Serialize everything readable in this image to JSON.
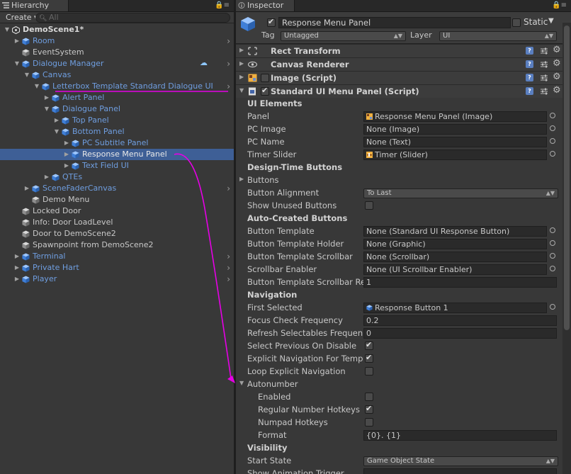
{
  "hierarchy": {
    "tab_label": "Hierarchy",
    "create_label": "Create ▾",
    "search_placeholder": "All",
    "items": [
      {
        "label": "DemoScene1*",
        "depth": 0,
        "expanded": true,
        "icon": "unity-scene-icon",
        "bold": true,
        "chevron": false
      },
      {
        "label": "Room",
        "depth": 1,
        "expanded": false,
        "icon": "prefab-cube-icon",
        "prefab": true,
        "chevron": true
      },
      {
        "label": "EventSystem",
        "depth": 1,
        "icon": "gameobject-cube-icon"
      },
      {
        "label": "Dialogue Manager",
        "depth": 1,
        "expanded": true,
        "icon": "prefab-cube-icon",
        "prefab": true,
        "chevron": true,
        "badge": true
      },
      {
        "label": "Canvas",
        "depth": 2,
        "expanded": true,
        "icon": "prefab-cube-icon",
        "prefab": true
      },
      {
        "label": "Letterbox Template Standard Dialogue UI",
        "depth": 3,
        "expanded": true,
        "icon": "prefab-cube-icon",
        "prefab": true,
        "chevron": true,
        "underline": true
      },
      {
        "label": "Alert Panel",
        "depth": 4,
        "expanded": false,
        "icon": "prefab-cube-icon",
        "prefab": true
      },
      {
        "label": "Dialogue Panel",
        "depth": 4,
        "expanded": true,
        "icon": "prefab-cube-icon",
        "prefab": true
      },
      {
        "label": "Top Panel",
        "depth": 5,
        "expanded": false,
        "icon": "prefab-cube-icon",
        "prefab": true
      },
      {
        "label": "Bottom Panel",
        "depth": 5,
        "expanded": true,
        "icon": "prefab-cube-icon",
        "prefab": true
      },
      {
        "label": "PC Subtitle Panel",
        "depth": 6,
        "expanded": false,
        "icon": "prefab-cube-icon",
        "prefab": true
      },
      {
        "label": "Response Menu Panel",
        "depth": 6,
        "expanded": false,
        "icon": "prefab-cube-icon",
        "prefab": true,
        "selected": true
      },
      {
        "label": "Text Field UI",
        "depth": 6,
        "expanded": false,
        "icon": "prefab-cube-icon",
        "prefab": true
      },
      {
        "label": "QTEs",
        "depth": 4,
        "expanded": false,
        "icon": "prefab-cube-icon",
        "prefab": true
      },
      {
        "label": "SceneFaderCanvas",
        "depth": 2,
        "expanded": false,
        "icon": "prefab-cube-icon",
        "prefab": true,
        "chevron": true
      },
      {
        "label": "Demo Menu",
        "depth": 2,
        "icon": "gameobject-cube-icon"
      },
      {
        "label": "Locked Door",
        "depth": 1,
        "icon": "gameobject-cube-icon"
      },
      {
        "label": "Info: Door LoadLevel",
        "depth": 1,
        "icon": "gameobject-cube-icon"
      },
      {
        "label": "Door to DemoScene2",
        "depth": 1,
        "icon": "gameobject-cube-icon"
      },
      {
        "label": "Spawnpoint from DemoScene2",
        "depth": 1,
        "icon": "gameobject-cube-icon"
      },
      {
        "label": "Terminal",
        "depth": 1,
        "expanded": false,
        "icon": "prefab-cube-icon",
        "prefab": true,
        "chevron": true
      },
      {
        "label": "Private Hart",
        "depth": 1,
        "expanded": false,
        "icon": "prefab-cube-icon",
        "prefab": true,
        "chevron": true
      },
      {
        "label": "Player",
        "depth": 1,
        "expanded": false,
        "icon": "prefab-cube-icon",
        "prefab": true,
        "chevron": true
      }
    ]
  },
  "inspector": {
    "tab_label": "Inspector",
    "object_name": "Response Menu Panel",
    "active": true,
    "static_label": "Static",
    "tag_label": "Tag",
    "tag_value": "Untagged",
    "layer_label": "Layer",
    "layer_value": "UI",
    "components": [
      {
        "title": "Rect Transform",
        "icon": "rect-transform-icon"
      },
      {
        "title": "Canvas Renderer",
        "icon": "eye-icon"
      },
      {
        "title": "Image (Script)",
        "icon": "image-script-icon",
        "checkbox": true,
        "checked": false
      },
      {
        "title": "Standard UI Menu Panel (Script)",
        "icon": "script-icon",
        "checkbox": true,
        "checked": true,
        "expanded": true
      }
    ],
    "properties": [
      {
        "type": "header",
        "label": "UI Elements"
      },
      {
        "type": "object",
        "label": "Panel",
        "value": "Response Menu Panel (Image)",
        "icon": "image-icon"
      },
      {
        "type": "object",
        "label": "PC Image",
        "value": "None (Image)"
      },
      {
        "type": "object",
        "label": "PC Name",
        "value": "None (Text)"
      },
      {
        "type": "object",
        "label": "Timer Slider",
        "value": "Timer (Slider)",
        "icon": "slider-icon"
      },
      {
        "type": "header",
        "label": "Design-Time Buttons"
      },
      {
        "type": "foldout",
        "label": "Buttons"
      },
      {
        "type": "dropdown",
        "label": "Button Alignment",
        "value": "To Last"
      },
      {
        "type": "toggle",
        "label": "Show Unused Buttons",
        "checked": false
      },
      {
        "type": "header",
        "label": "Auto-Created Buttons"
      },
      {
        "type": "object",
        "label": "Button Template",
        "value": "None (Standard UI Response Button)"
      },
      {
        "type": "object",
        "label": "Button Template Holder",
        "value": "None (Graphic)"
      },
      {
        "type": "object",
        "label": "Button Template Scrollbar",
        "value": "None (Scrollbar)"
      },
      {
        "type": "object",
        "label": "Scrollbar Enabler",
        "value": "None (UI Scrollbar Enabler)"
      },
      {
        "type": "text",
        "label": "Button Template Scrollbar Re",
        "value": "1"
      },
      {
        "type": "header",
        "label": "Navigation"
      },
      {
        "type": "object",
        "label": "First Selected",
        "value": "Response Button 1",
        "icon": "prefab-cube-icon"
      },
      {
        "type": "text",
        "label": "Focus Check Frequency",
        "value": "0.2"
      },
      {
        "type": "text",
        "label": "Refresh Selectables Frequen",
        "value": "0"
      },
      {
        "type": "toggle",
        "label": "Select Previous On Disable",
        "checked": true
      },
      {
        "type": "toggle",
        "label": "Explicit Navigation For Temp",
        "checked": true
      },
      {
        "type": "toggle",
        "label": "Loop Explicit Navigation",
        "checked": false
      },
      {
        "type": "foldout-open",
        "label": "Autonumber"
      },
      {
        "type": "toggle",
        "label": "Enabled",
        "checked": false,
        "indent": true
      },
      {
        "type": "toggle",
        "label": "Regular Number Hotkeys",
        "checked": true,
        "indent": true
      },
      {
        "type": "toggle",
        "label": "Numpad Hotkeys",
        "checked": false,
        "indent": true
      },
      {
        "type": "text",
        "label": "Format",
        "value": "{0}. {1}",
        "indent": true
      },
      {
        "type": "header",
        "label": "Visibility"
      },
      {
        "type": "dropdown",
        "label": "Start State",
        "value": "Game Object State"
      },
      {
        "type": "text",
        "label": "Show Animation Trigger",
        "value": ""
      }
    ]
  },
  "colors": {
    "prefab_text": "#6f9ee0",
    "selection": "#3e5f96",
    "annotation": "#e600e6",
    "panel_bg": "#383838"
  }
}
